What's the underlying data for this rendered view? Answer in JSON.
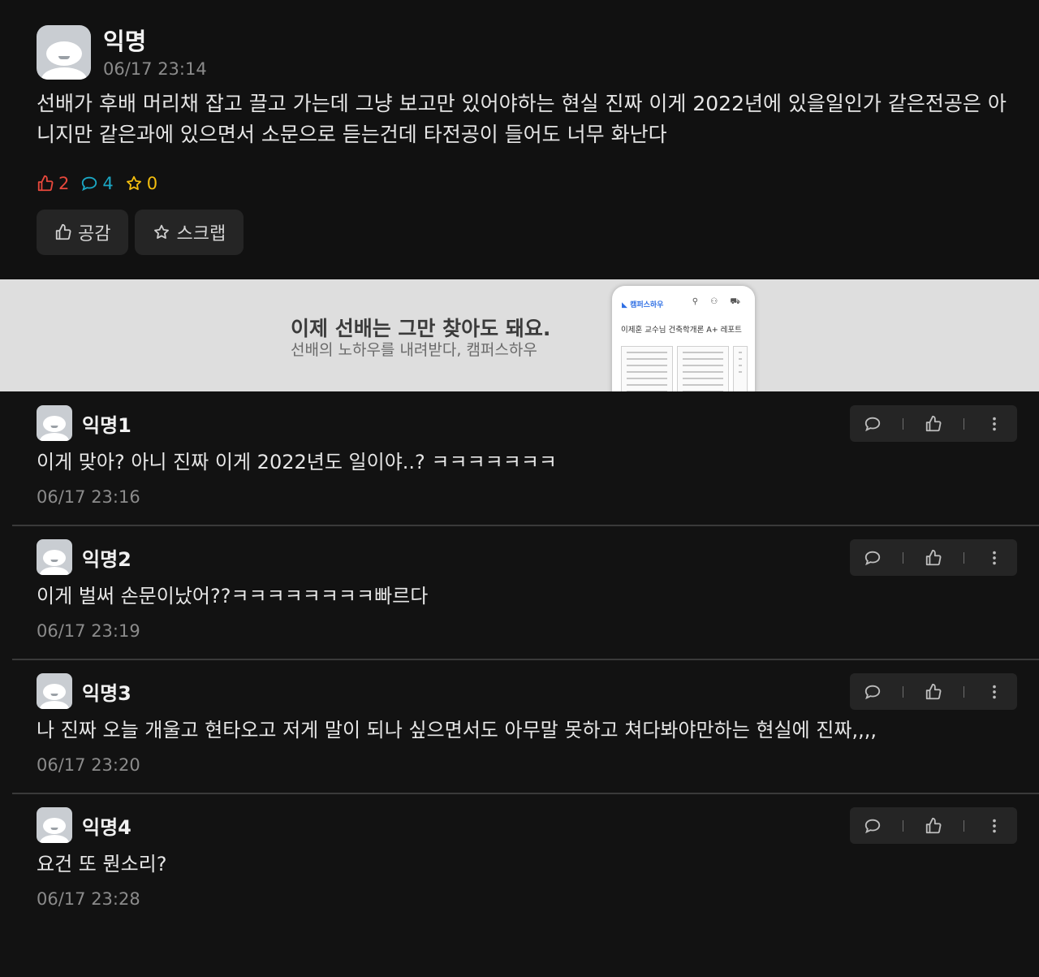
{
  "post": {
    "author": "익명",
    "date": "06/17 23:14",
    "body": "선배가 후배 머리채 잡고 끌고 가는데 그냥 보고만 있어야하는 현실 진짜 이게 2022년에 있을일인가 같은전공은 아니지만 같은과에 있으면서 소문으로 듣는건데 타전공이 들어도 너무 화난다",
    "likes": "2",
    "comments": "4",
    "scraps": "0",
    "like_button": "공감",
    "scrap_button": "스크랩"
  },
  "banner": {
    "title": "이제 선배는 그만 찾아도 돼요.",
    "subtitle": "선배의 노하우를 내려받다, 캠퍼스하우",
    "phone_logo": "캠퍼스하우",
    "phone_title": "이제훈 교수님 건축학개론 A+ 레포트"
  },
  "comments": [
    {
      "author": "익명1",
      "text": "이게 맞아? 아니 진짜 이게 2022년도 일이야..? ㅋㅋㅋㅋㅋㅋㅋ",
      "date": "06/17 23:16"
    },
    {
      "author": "익명2",
      "text": "이게 벌써 손문이났어??ㅋㅋㅋㅋㅋㅋㅋㅋ빠르다",
      "date": "06/17 23:19"
    },
    {
      "author": "익명3",
      "text": "나 진짜 오늘 개울고 현타오고 저게 말이 되나 싶으면서도 아무말 못하고 쳐다봐야만하는 현실에 진짜,,,,",
      "date": "06/17 23:20"
    },
    {
      "author": "익명4",
      "text": "요건 또 뭔소리?",
      "date": "06/17 23:28"
    }
  ],
  "colors": {
    "background": "#121212",
    "like": "#e8483c",
    "comment": "#1ba7c4",
    "scrap": "#f2bd0e"
  }
}
